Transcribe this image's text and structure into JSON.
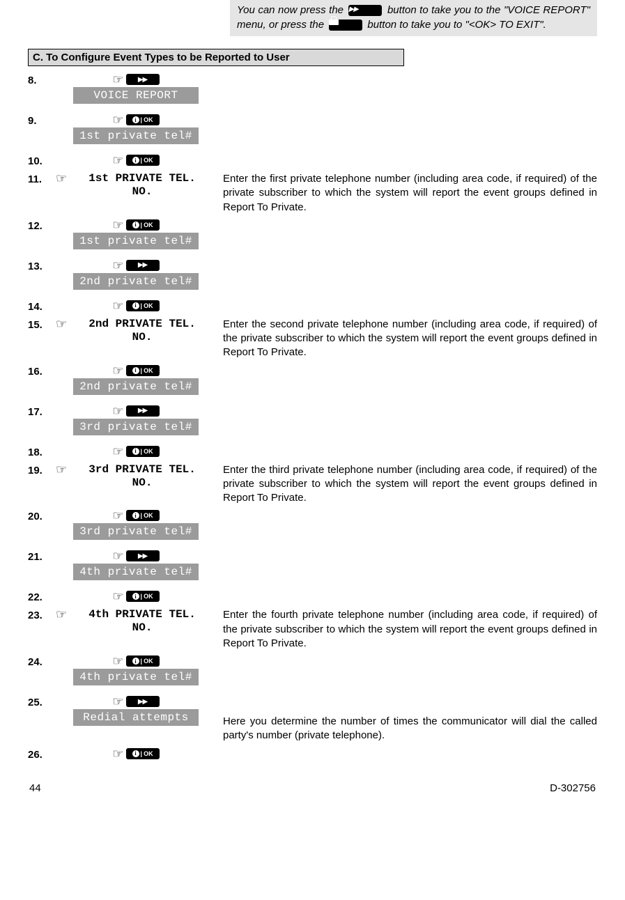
{
  "note": {
    "part1": "You can now press the ",
    "part2": " button to take you to the \"VOICE REPORT\" menu",
    "part3": ", or press the ",
    "part4": " button to take you to \"<OK>  TO EXIT\"."
  },
  "sectionHeader": "C. To Configure Event Types to be Reported to User",
  "steps": {
    "s8": {
      "num": "8.",
      "lcd": "VOICE REPORT"
    },
    "s9": {
      "num": "9.",
      "lcd": "1st private tel#"
    },
    "s10": {
      "num": "10."
    },
    "s11": {
      "num": "11.",
      "prompt1": "1st PRIVATE TEL.",
      "prompt2": "NO.",
      "desc": "Enter the first private telephone number (including area code, if required) of the private subscriber to which the system will report the event groups defined in Report To Private."
    },
    "s12": {
      "num": "12.",
      "lcd": "1st private tel#"
    },
    "s13": {
      "num": "13.",
      "lcd": "2nd private tel#"
    },
    "s14": {
      "num": "14."
    },
    "s15": {
      "num": "15.",
      "prompt1": "2nd PRIVATE TEL.",
      "prompt2": "NO.",
      "desc": "Enter the second private telephone number (including area code, if required) of the private subscriber to which the system will report the event groups defined in Report To Private."
    },
    "s16": {
      "num": "16.",
      "lcd": "2nd private tel#"
    },
    "s17": {
      "num": "17.",
      "lcd": "3rd private tel#"
    },
    "s18": {
      "num": "18."
    },
    "s19": {
      "num": "19.",
      "prompt1": "3rd PRIVATE TEL.",
      "prompt2": "NO.",
      "desc": "Enter the third private telephone number (including area code, if required) of the private subscriber to which the system will report the event groups defined in Report To Private."
    },
    "s20": {
      "num": "20.",
      "lcd": "3rd private tel#"
    },
    "s21": {
      "num": "21.",
      "lcd": "4th private tel#"
    },
    "s22": {
      "num": "22."
    },
    "s23": {
      "num": "23.",
      "prompt1": "4th PRIVATE TEL.",
      "prompt2": "NO.",
      "desc": "Enter the fourth private telephone number (including area code, if required) of the private subscriber to which the system will report the event groups defined in Report To Private."
    },
    "s24": {
      "num": "24.",
      "lcd": "4th private tel#"
    },
    "s25": {
      "num": "25.",
      "lcd": "Redial attempts",
      "desc": "Here you determine the number of times the communicator will dial the called party's number (private telephone)."
    },
    "s26": {
      "num": "26."
    }
  },
  "buttons": {
    "okText": "OK",
    "infoChar": "i"
  },
  "footer": {
    "pageNum": "44",
    "docId": "D-302756"
  }
}
